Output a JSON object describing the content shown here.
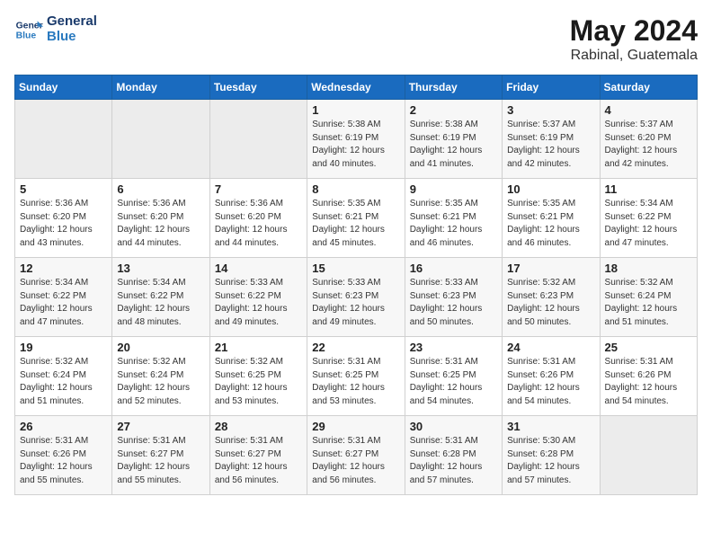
{
  "logo": {
    "line1": "General",
    "line2": "Blue"
  },
  "title": "May 2024",
  "location": "Rabinal, Guatemala",
  "weekdays": [
    "Sunday",
    "Monday",
    "Tuesday",
    "Wednesday",
    "Thursday",
    "Friday",
    "Saturday"
  ],
  "weeks": [
    [
      {
        "day": "",
        "empty": true
      },
      {
        "day": "",
        "empty": true
      },
      {
        "day": "",
        "empty": true
      },
      {
        "day": "1",
        "sunrise": "5:38 AM",
        "sunset": "6:19 PM",
        "daylight": "12 hours and 40 minutes."
      },
      {
        "day": "2",
        "sunrise": "5:38 AM",
        "sunset": "6:19 PM",
        "daylight": "12 hours and 41 minutes."
      },
      {
        "day": "3",
        "sunrise": "5:37 AM",
        "sunset": "6:19 PM",
        "daylight": "12 hours and 42 minutes."
      },
      {
        "day": "4",
        "sunrise": "5:37 AM",
        "sunset": "6:20 PM",
        "daylight": "12 hours and 42 minutes."
      }
    ],
    [
      {
        "day": "5",
        "sunrise": "5:36 AM",
        "sunset": "6:20 PM",
        "daylight": "12 hours and 43 minutes."
      },
      {
        "day": "6",
        "sunrise": "5:36 AM",
        "sunset": "6:20 PM",
        "daylight": "12 hours and 44 minutes."
      },
      {
        "day": "7",
        "sunrise": "5:36 AM",
        "sunset": "6:20 PM",
        "daylight": "12 hours and 44 minutes."
      },
      {
        "day": "8",
        "sunrise": "5:35 AM",
        "sunset": "6:21 PM",
        "daylight": "12 hours and 45 minutes."
      },
      {
        "day": "9",
        "sunrise": "5:35 AM",
        "sunset": "6:21 PM",
        "daylight": "12 hours and 46 minutes."
      },
      {
        "day": "10",
        "sunrise": "5:35 AM",
        "sunset": "6:21 PM",
        "daylight": "12 hours and 46 minutes."
      },
      {
        "day": "11",
        "sunrise": "5:34 AM",
        "sunset": "6:22 PM",
        "daylight": "12 hours and 47 minutes."
      }
    ],
    [
      {
        "day": "12",
        "sunrise": "5:34 AM",
        "sunset": "6:22 PM",
        "daylight": "12 hours and 47 minutes."
      },
      {
        "day": "13",
        "sunrise": "5:34 AM",
        "sunset": "6:22 PM",
        "daylight": "12 hours and 48 minutes."
      },
      {
        "day": "14",
        "sunrise": "5:33 AM",
        "sunset": "6:22 PM",
        "daylight": "12 hours and 49 minutes."
      },
      {
        "day": "15",
        "sunrise": "5:33 AM",
        "sunset": "6:23 PM",
        "daylight": "12 hours and 49 minutes."
      },
      {
        "day": "16",
        "sunrise": "5:33 AM",
        "sunset": "6:23 PM",
        "daylight": "12 hours and 50 minutes."
      },
      {
        "day": "17",
        "sunrise": "5:32 AM",
        "sunset": "6:23 PM",
        "daylight": "12 hours and 50 minutes."
      },
      {
        "day": "18",
        "sunrise": "5:32 AM",
        "sunset": "6:24 PM",
        "daylight": "12 hours and 51 minutes."
      }
    ],
    [
      {
        "day": "19",
        "sunrise": "5:32 AM",
        "sunset": "6:24 PM",
        "daylight": "12 hours and 51 minutes."
      },
      {
        "day": "20",
        "sunrise": "5:32 AM",
        "sunset": "6:24 PM",
        "daylight": "12 hours and 52 minutes."
      },
      {
        "day": "21",
        "sunrise": "5:32 AM",
        "sunset": "6:25 PM",
        "daylight": "12 hours and 53 minutes."
      },
      {
        "day": "22",
        "sunrise": "5:31 AM",
        "sunset": "6:25 PM",
        "daylight": "12 hours and 53 minutes."
      },
      {
        "day": "23",
        "sunrise": "5:31 AM",
        "sunset": "6:25 PM",
        "daylight": "12 hours and 54 minutes."
      },
      {
        "day": "24",
        "sunrise": "5:31 AM",
        "sunset": "6:26 PM",
        "daylight": "12 hours and 54 minutes."
      },
      {
        "day": "25",
        "sunrise": "5:31 AM",
        "sunset": "6:26 PM",
        "daylight": "12 hours and 54 minutes."
      }
    ],
    [
      {
        "day": "26",
        "sunrise": "5:31 AM",
        "sunset": "6:26 PM",
        "daylight": "12 hours and 55 minutes."
      },
      {
        "day": "27",
        "sunrise": "5:31 AM",
        "sunset": "6:27 PM",
        "daylight": "12 hours and 55 minutes."
      },
      {
        "day": "28",
        "sunrise": "5:31 AM",
        "sunset": "6:27 PM",
        "daylight": "12 hours and 56 minutes."
      },
      {
        "day": "29",
        "sunrise": "5:31 AM",
        "sunset": "6:27 PM",
        "daylight": "12 hours and 56 minutes."
      },
      {
        "day": "30",
        "sunrise": "5:31 AM",
        "sunset": "6:28 PM",
        "daylight": "12 hours and 57 minutes."
      },
      {
        "day": "31",
        "sunrise": "5:30 AM",
        "sunset": "6:28 PM",
        "daylight": "12 hours and 57 minutes."
      },
      {
        "day": "",
        "empty": true
      }
    ]
  ],
  "labels": {
    "sunrise": "Sunrise:",
    "sunset": "Sunset:",
    "daylight": "Daylight:"
  }
}
